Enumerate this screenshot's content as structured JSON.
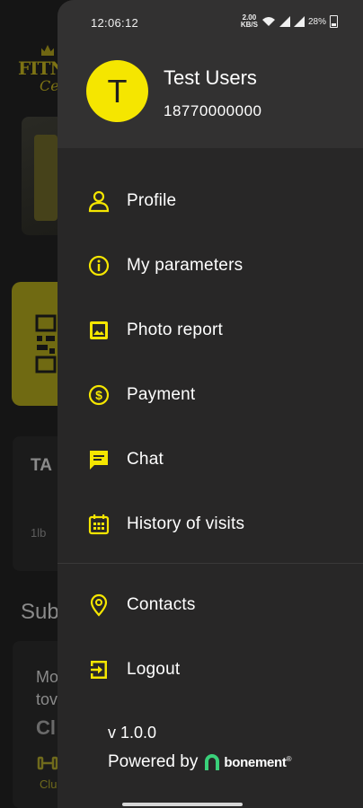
{
  "status_bar": {
    "time": "12:06:12",
    "network_speed": "2.00",
    "network_unit": "KB/S",
    "battery": "28%"
  },
  "user": {
    "avatar_initial": "T",
    "name": "Test Users",
    "phone": "18770000000"
  },
  "menu": {
    "items": [
      {
        "label": "Profile",
        "icon": "person-icon"
      },
      {
        "label": "My parameters",
        "icon": "info-icon"
      },
      {
        "label": "Photo report",
        "icon": "image-icon"
      },
      {
        "label": "Payment",
        "icon": "dollar-coin-icon"
      },
      {
        "label": "Chat",
        "icon": "chat-icon"
      },
      {
        "label": "History of visits",
        "icon": "calendar-icon"
      }
    ],
    "secondary_items": [
      {
        "label": "Contacts",
        "icon": "location-pin-icon"
      },
      {
        "label": "Logout",
        "icon": "logout-icon"
      }
    ]
  },
  "footer": {
    "version": "v 1.0.0",
    "powered_by": "Powered by",
    "brand_name": "bonement",
    "brand_mark": "®"
  },
  "background_app": {
    "logo_line1": "FITN",
    "logo_line2": "Cen",
    "card_title": "TA",
    "card_unit": "1lb",
    "section_title": "Sub",
    "card2_text": "Mo\ntov",
    "card2_code": "Cl",
    "card2_label": "Clu"
  },
  "colors": {
    "accent": "#F5E600",
    "drawer_bg": "#282727",
    "header_bg": "#323131"
  }
}
